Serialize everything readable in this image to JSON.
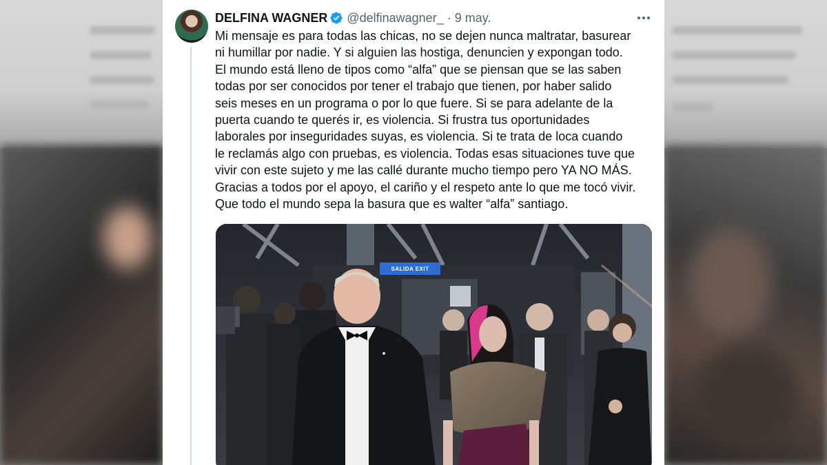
{
  "tweet": {
    "author_name": "DELFINA WAGNER",
    "handle": "@delfinawagner_",
    "separator": "·",
    "date": "9 may.",
    "text_lines": [
      "Mi mensaje es para todas las chicas, no se dejen nunca maltratar, basurear",
      "ni humillar por nadie. Y si alguien las hostiga, denuncien y expongan todo.",
      "El mundo está lleno de tipos como “alfa” que se piensan que se las saben",
      "todas por ser conocidos por tener el trabajo que tienen, por haber salido",
      "seis meses en un programa o por lo que fuere. Si se para adelante de la",
      "puerta cuando te querés ir, es violencia. Si frustra tus oportunidades",
      "laborales por inseguridades suyas, es violencia. Si te trata de loca cuando",
      "le reclamás algo con pruebas, es violencia. Todas esas situaciones tuve que",
      "vivir con este sujeto y me las callé durante mucho tiempo pero YA NO MÁS.",
      "Gracias a todos por el apoyo, el cariño y el respeto ante lo que me tocó vivir.",
      "Que todo el mundo sepa la basura que es walter “alfa” santiago."
    ],
    "photo_sign_text": "SALIDA EXIT"
  },
  "icons": {
    "verified": "verified-badge-icon",
    "more": "more-options-icon"
  },
  "colors": {
    "verified_blue": "#1d9bf0",
    "text": "#0f1419",
    "secondary_text": "#536471"
  }
}
